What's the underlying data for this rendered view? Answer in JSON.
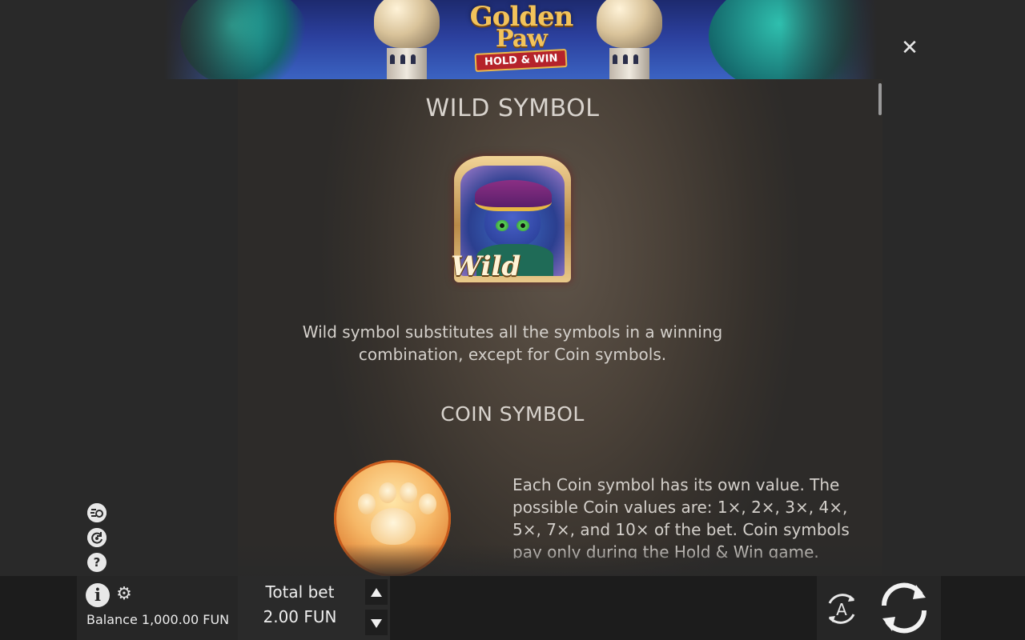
{
  "header": {
    "logo": {
      "line1": "Golden",
      "line2": "Paw",
      "ribbon": "HOLD & WIN"
    },
    "close_icon": "close-icon"
  },
  "sections": {
    "wild": {
      "title": "WILD SYMBOL",
      "symbol_label": "Wild",
      "description": "Wild symbol substitutes all the symbols in a winning combination, except for Coin symbols."
    },
    "coin": {
      "title": "COIN SYMBOL",
      "description": "Each Coin symbol has its own value. The possible Coin values are: 1×, 2×, 3×, 4×, 5×, 7×, and 10× of the bet. Coin symbols pay only during the Hold & Win game."
    }
  },
  "side_icons": [
    "turbo-icon",
    "replay-icon",
    "help-icon"
  ],
  "bottom_bar": {
    "info_icon": "i",
    "balance": "Balance 1,000.00 FUN",
    "total_bet_label": "Total bet",
    "total_bet_value": "2.00 FUN",
    "autoplay_label": "A"
  },
  "colors": {
    "background": "#292929",
    "bottom_bar": "#1c1c1c",
    "text": "#d6d2cc",
    "logo_gold": "#f2c35b",
    "ribbon_red": "#b5232b"
  }
}
